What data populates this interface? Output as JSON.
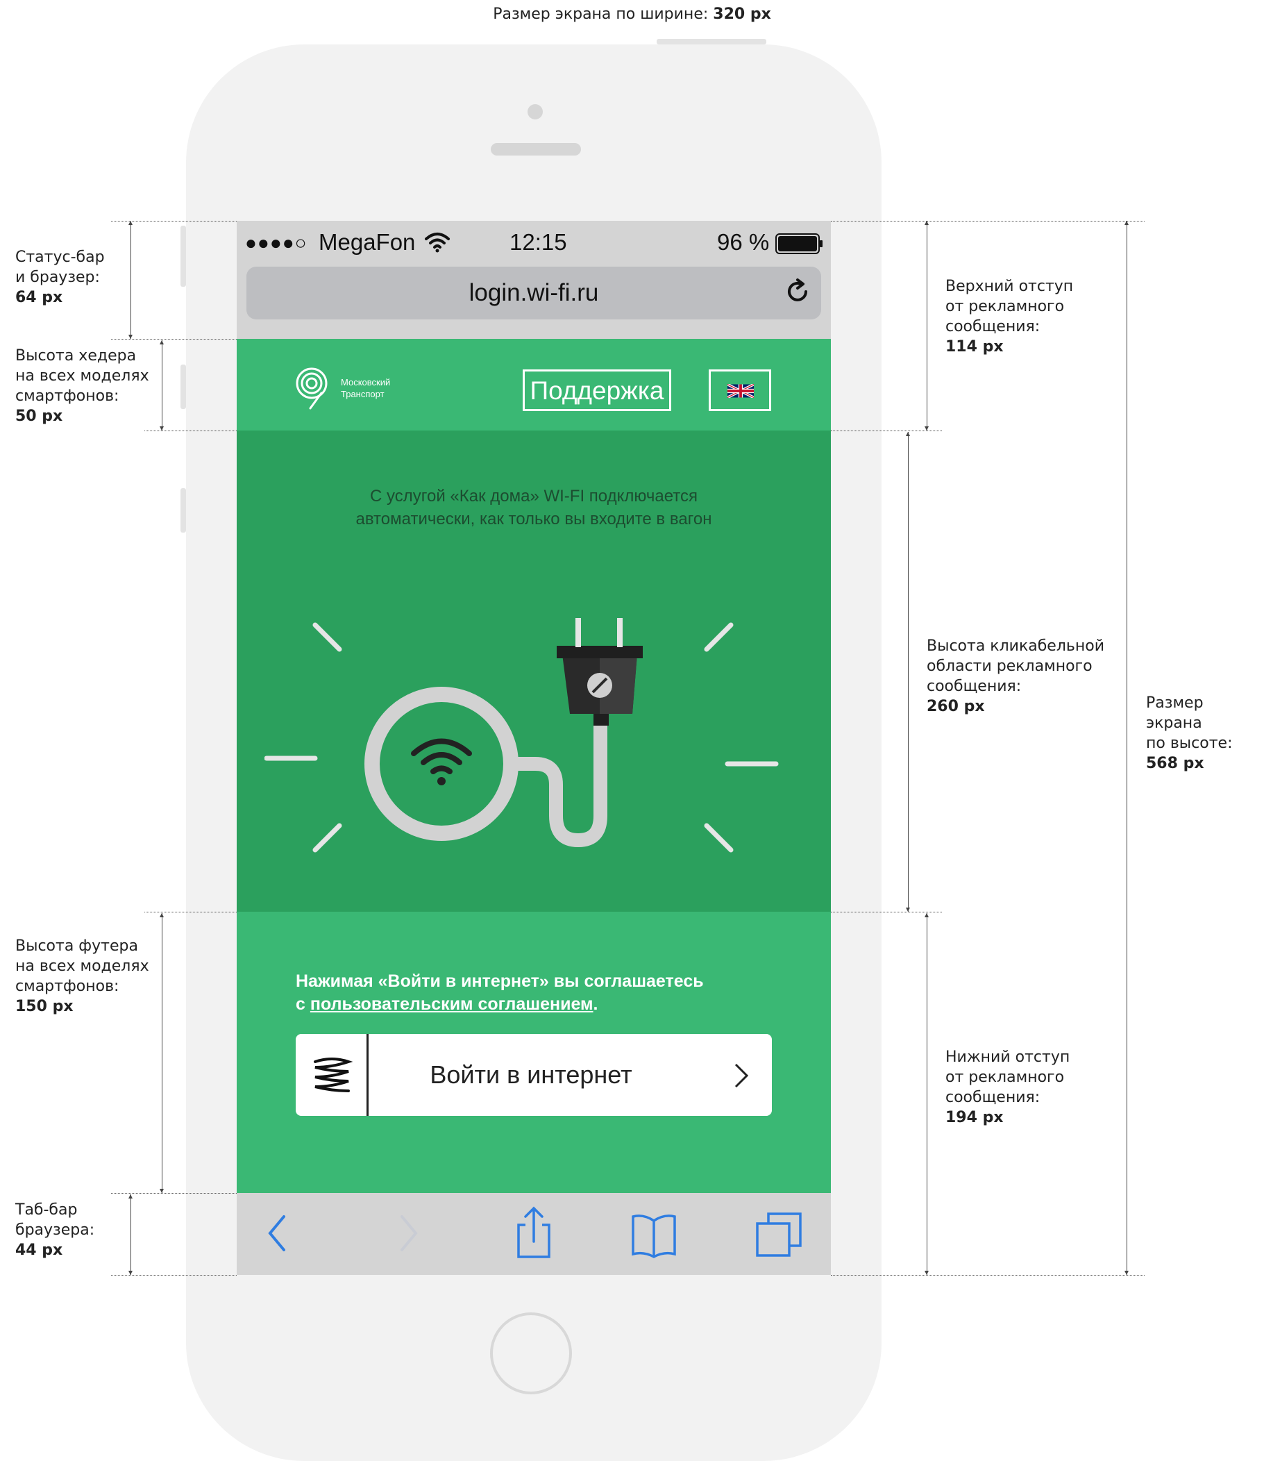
{
  "top_note": {
    "text": "Размер экрана по ширине:",
    "value": "320 px"
  },
  "left_notes": [
    {
      "lines": "Статус-бар\nи браузер:",
      "value": "64 px"
    },
    {
      "lines": "Высота хедера\nна всех моделях\nсмартфонов:",
      "value": "50 px"
    },
    {
      "lines": "Высота футера\nна всех моделях\nсмартфонов:",
      "value": "150 px"
    },
    {
      "lines": "Таб-бар\nбраузера:",
      "value": "44 px"
    }
  ],
  "right_notes": [
    {
      "lines": "Верхний отступ\nот рекламного\nсообщения:",
      "value": "114 px"
    },
    {
      "lines": "Высота кликабельной\nобласти рекламного\nсообщения:",
      "value": "260 px"
    },
    {
      "lines": "Нижний отступ\nот рекламного\nсообщения:",
      "value": "194 px"
    },
    {
      "lines": "Размер экрана\nпо высоте:",
      "value": "568 px"
    }
  ],
  "status_bar": {
    "signal": "●●●●○",
    "carrier": "MegaFon",
    "time": "12:15",
    "battery": "96 %"
  },
  "browser": {
    "url": "login.wi-fi.ru",
    "reload_icon": "reload-icon"
  },
  "header": {
    "logo_line1": "Московский",
    "logo_line2": "Транспорт",
    "support_label": "Поддержка",
    "language_icon": "uk-flag-icon"
  },
  "banner": {
    "line1": "С услугой «Как дома» WI-FI подключается",
    "line2": "автоматически, как только вы входите в вагон"
  },
  "footer": {
    "agreement_prefix": "Нажимая «Войти в интернет» вы соглашаетесь",
    "agreement_with": "с",
    "agreement_link": "пользовательским соглашением",
    "agreement_suffix": ".",
    "login_label": "Войти в интернет"
  },
  "tab_bar": {
    "icons": [
      "back-icon",
      "forward-icon",
      "share-icon",
      "bookmarks-icon",
      "tabs-icon"
    ]
  },
  "colors": {
    "header_green": "#3ab874",
    "banner_green": "#2ba05d",
    "ios_blue": "#2f7de1"
  }
}
